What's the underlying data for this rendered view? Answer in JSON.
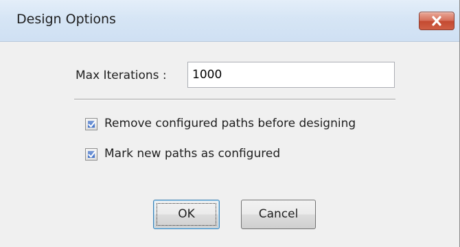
{
  "dialog": {
    "title": "Design Options",
    "close_icon": "close-icon",
    "max_iterations": {
      "label": "Max Iterations :",
      "value": "1000"
    },
    "options": [
      {
        "label": "Remove configured paths before designing",
        "checked": true
      },
      {
        "label": "Mark new paths as configured",
        "checked": true
      }
    ],
    "buttons": {
      "ok_label": "OK",
      "cancel_label": "Cancel"
    },
    "colors": {
      "title_bar": "#d6e5f5",
      "close_button": "#c9543b",
      "dialog_background": "#f0f0f0",
      "checkbox_check": "#3d6fc8"
    }
  }
}
